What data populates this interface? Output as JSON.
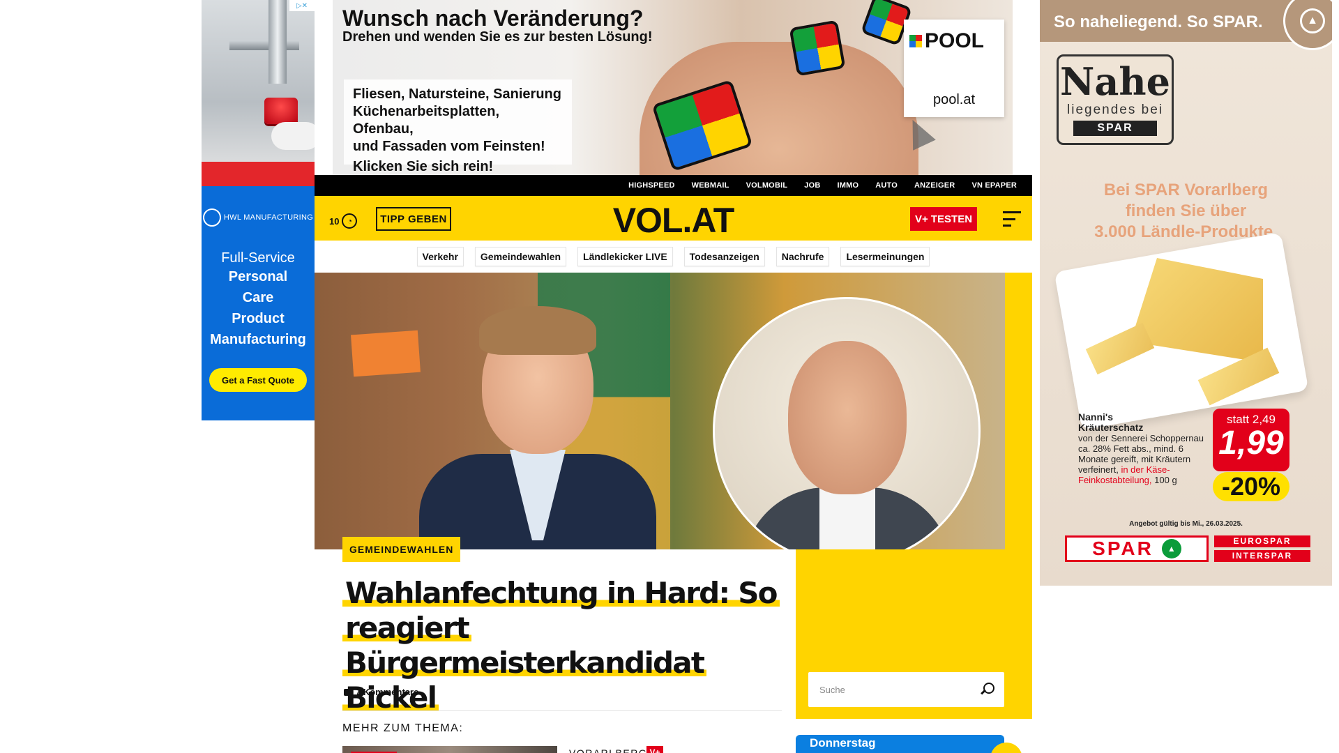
{
  "left_ad": {
    "adchoices_label": "▷✕",
    "brand": "HWL MANUFACTURING",
    "line1": "Full-Service",
    "line2": "Personal",
    "line3": "Care",
    "line4": "Product",
    "line5": "Manufacturing",
    "cta": "Get a Fast Quote"
  },
  "top_ad": {
    "headline": "Wunsch nach Veränderung?",
    "subline": "Drehen und wenden Sie es zur besten Lösung!",
    "box_line1": "Fliesen, Natursteine, Sanierung",
    "box_line2": "Küchenarbeitsplatten, Ofenbau,",
    "box_line3": "und Fassaden vom Feinsten!",
    "box_cta": "Klicken Sie sich rein!",
    "brand": "POOL",
    "url": "pool.at"
  },
  "right_ad": {
    "slogan": "So naheliegend. So SPAR.",
    "badge_big": "Nahe",
    "badge_small": "liegendes bei",
    "badge_brand": "SPAR",
    "copy_line1": "Bei SPAR Vorarlberg",
    "copy_line2": "finden Sie über",
    "copy_line3": "3.000 Ländle-Produkte.",
    "product_name1": "Nanni's",
    "product_name2": "Kräuterschatz",
    "product_desc": "von der Sennerei Schoppernau ca. 28% Fett abs., mind. 6 Monate gereift, mit Kräutern verfeinert,",
    "product_desc_red": "in der Käse-Feinkostabteilung,",
    "product_weight": "100 g",
    "was_price": "statt 2,49",
    "price": "1,99",
    "discount": "-20%",
    "validity": "Angebot gültig bis Mi., 26.03.2025.",
    "logo": "SPAR",
    "sub_logo1": "EUROSPAR",
    "sub_logo2": "INTERSPAR"
  },
  "topnav": {
    "items": [
      "HIGHSPEED",
      "WEBMAIL",
      "VOLMOBIL",
      "JOB",
      "IMMO",
      "AUTO",
      "ANZEIGER",
      "VN EPAPER"
    ]
  },
  "header": {
    "temperature": "10",
    "tipp_label": "TIPP GEBEN",
    "site_name": "VOL.AT",
    "vplus_label": "V+ TESTEN"
  },
  "tags": [
    "Verkehr",
    "Gemeindewahlen",
    "Ländlekicker LIVE",
    "Todesanzeigen",
    "Nachrufe",
    "Lesermeinungen"
  ],
  "article": {
    "category": "GEMEINDEWAHLEN",
    "title_line1": "Wahlanfechtung in Hard: So",
    "title_line2": "reagiert",
    "title_line3": "Bürgermeisterkandidat Bickel",
    "comments": "7 Kommentare",
    "related_heading": "MEHR ZUM THEMA:",
    "related_region": "VORARLBERG",
    "related_badge": "V+"
  },
  "sidebar": {
    "search_placeholder": "Suche",
    "weather_title": "Donnerstag"
  },
  "colors": {
    "brand_yellow": "#ffd400",
    "accent_red": "#e2001a",
    "ad_blue": "#0a6cd8"
  }
}
